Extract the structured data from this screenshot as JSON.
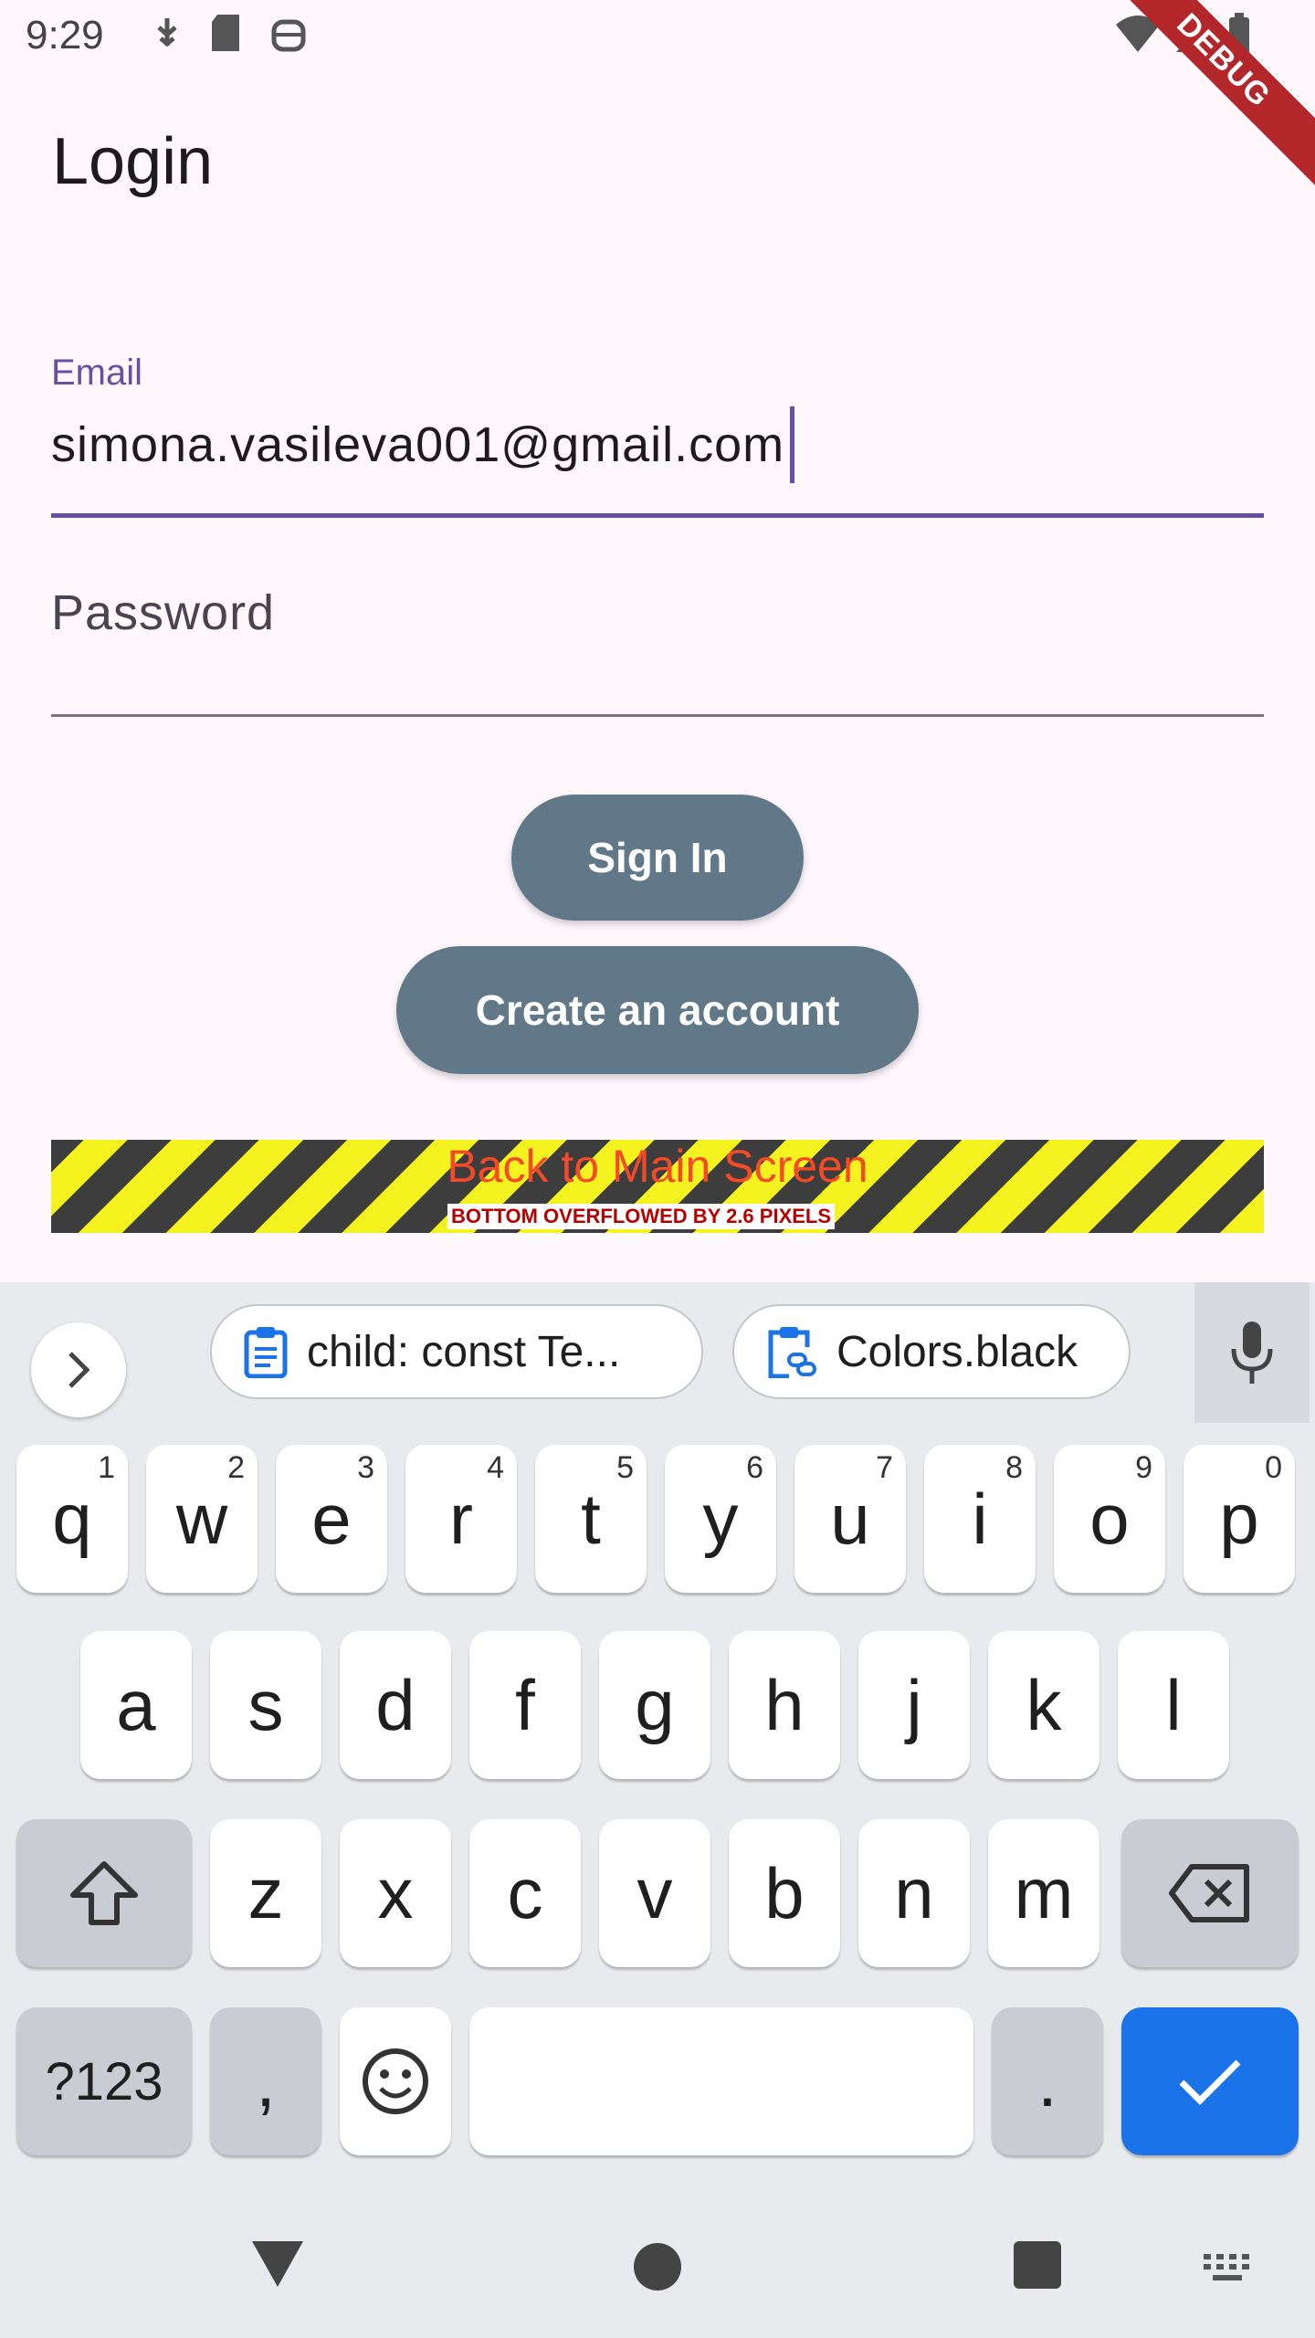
{
  "status_bar": {
    "time": "9:29",
    "left_icons": [
      "usb-debug-icon",
      "sd-card-icon",
      "android-robot-icon"
    ],
    "right_icons": [
      "wifi-icon",
      "signal-icon",
      "battery-icon"
    ],
    "debug_banner": "DEBUG"
  },
  "page": {
    "title": "Login"
  },
  "email": {
    "label": "Email",
    "value": "simona.vasileva001@gmail.com"
  },
  "password": {
    "placeholder": "Password"
  },
  "buttons": {
    "sign_in": "Sign In",
    "create_account": "Create an account"
  },
  "overflow": {
    "back_text": "Back to Main Screen",
    "warning": "BOTTOM OVERFLOWED BY 2.6 PIXELS"
  },
  "keyboard": {
    "suggestions": [
      {
        "icon": "clipboard-text-icon",
        "text": "child: const Te..."
      },
      {
        "icon": "clipboard-link-icon",
        "text": "Colors.black"
      }
    ],
    "row1": [
      {
        "k": "q",
        "h": "1"
      },
      {
        "k": "w",
        "h": "2"
      },
      {
        "k": "e",
        "h": "3"
      },
      {
        "k": "r",
        "h": "4"
      },
      {
        "k": "t",
        "h": "5"
      },
      {
        "k": "y",
        "h": "6"
      },
      {
        "k": "u",
        "h": "7"
      },
      {
        "k": "i",
        "h": "8"
      },
      {
        "k": "o",
        "h": "9"
      },
      {
        "k": "p",
        "h": "0"
      }
    ],
    "row2": [
      "a",
      "s",
      "d",
      "f",
      "g",
      "h",
      "j",
      "k",
      "l"
    ],
    "row3": [
      "z",
      "x",
      "c",
      "v",
      "b",
      "n",
      "m"
    ],
    "symbols_key": "?123",
    "comma_key": ",",
    "period_key": "."
  },
  "colors": {
    "primary": "#6750a4",
    "button": "#607888",
    "enter_key": "#1a73e8",
    "debug_banner": "#b3262a"
  }
}
